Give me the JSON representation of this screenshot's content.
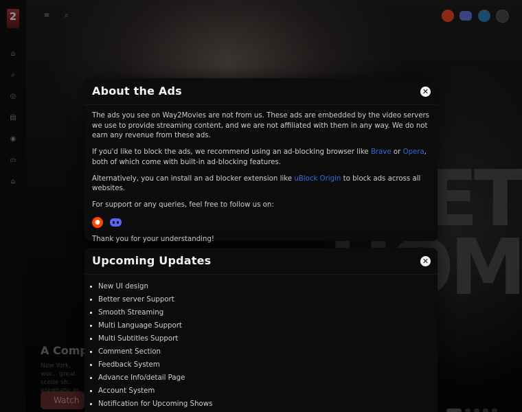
{
  "background": {
    "title_lines": [
      "PLET",
      "HOMI"
    ],
    "hero_title": "A Complete",
    "hero_description": "New York, wor... great scene sh... enigmatic lo...",
    "hero_watch_label": "Watch"
  },
  "sidebar": {
    "logo_text": "2",
    "items": [
      {
        "icon": "home-icon"
      },
      {
        "icon": "search-icon"
      },
      {
        "icon": "compass-icon"
      },
      {
        "icon": "movie-icon"
      },
      {
        "icon": "tv-icon"
      },
      {
        "icon": "bookmark-icon"
      },
      {
        "icon": "lock-icon"
      }
    ]
  },
  "topbar": {
    "menu_icon": "menu-icon",
    "search_icon": "search-icon",
    "socials": [
      "reddit-icon",
      "discord-icon",
      "telegram-icon"
    ]
  },
  "about_modal": {
    "title": "About the Ads",
    "para1": "The ads you see on Way2Movies are not from us. These ads are embedded by the video servers we use to provide streaming content, and we are not affiliated with them in any way. We do not earn any revenue from these ads.",
    "para2_prefix": "If you'd like to block the ads, we recommend using an ad-blocking browser like ",
    "link_brave": "Brave",
    "para2_mid": " or ",
    "link_opera": "Opera",
    "para2_suffix": ", both of which come with built-in ad-blocking features.",
    "para3_prefix": "Alternatively, you can install an ad blocker extension like ",
    "link_ublock": "uBlock Origin",
    "para3_suffix": " to block ads across all websites.",
    "para4": "For support or any queries, feel free to follow us on:",
    "thanks": "Thank you for your understanding!",
    "colors": {
      "link": "#2f6dde",
      "reddit": "#ff4500",
      "discord": "#5865f2"
    }
  },
  "updates_modal": {
    "title": "Upcoming Updates",
    "items": [
      "New UI design",
      "Better server Support",
      "Smooth Streaming",
      "Multi Language Support",
      "Multi Subtitles Support",
      "Comment Section",
      "Feedback System",
      "Advance Info/detail Page",
      "Account System",
      "Notification for Upcoming Shows"
    ]
  }
}
